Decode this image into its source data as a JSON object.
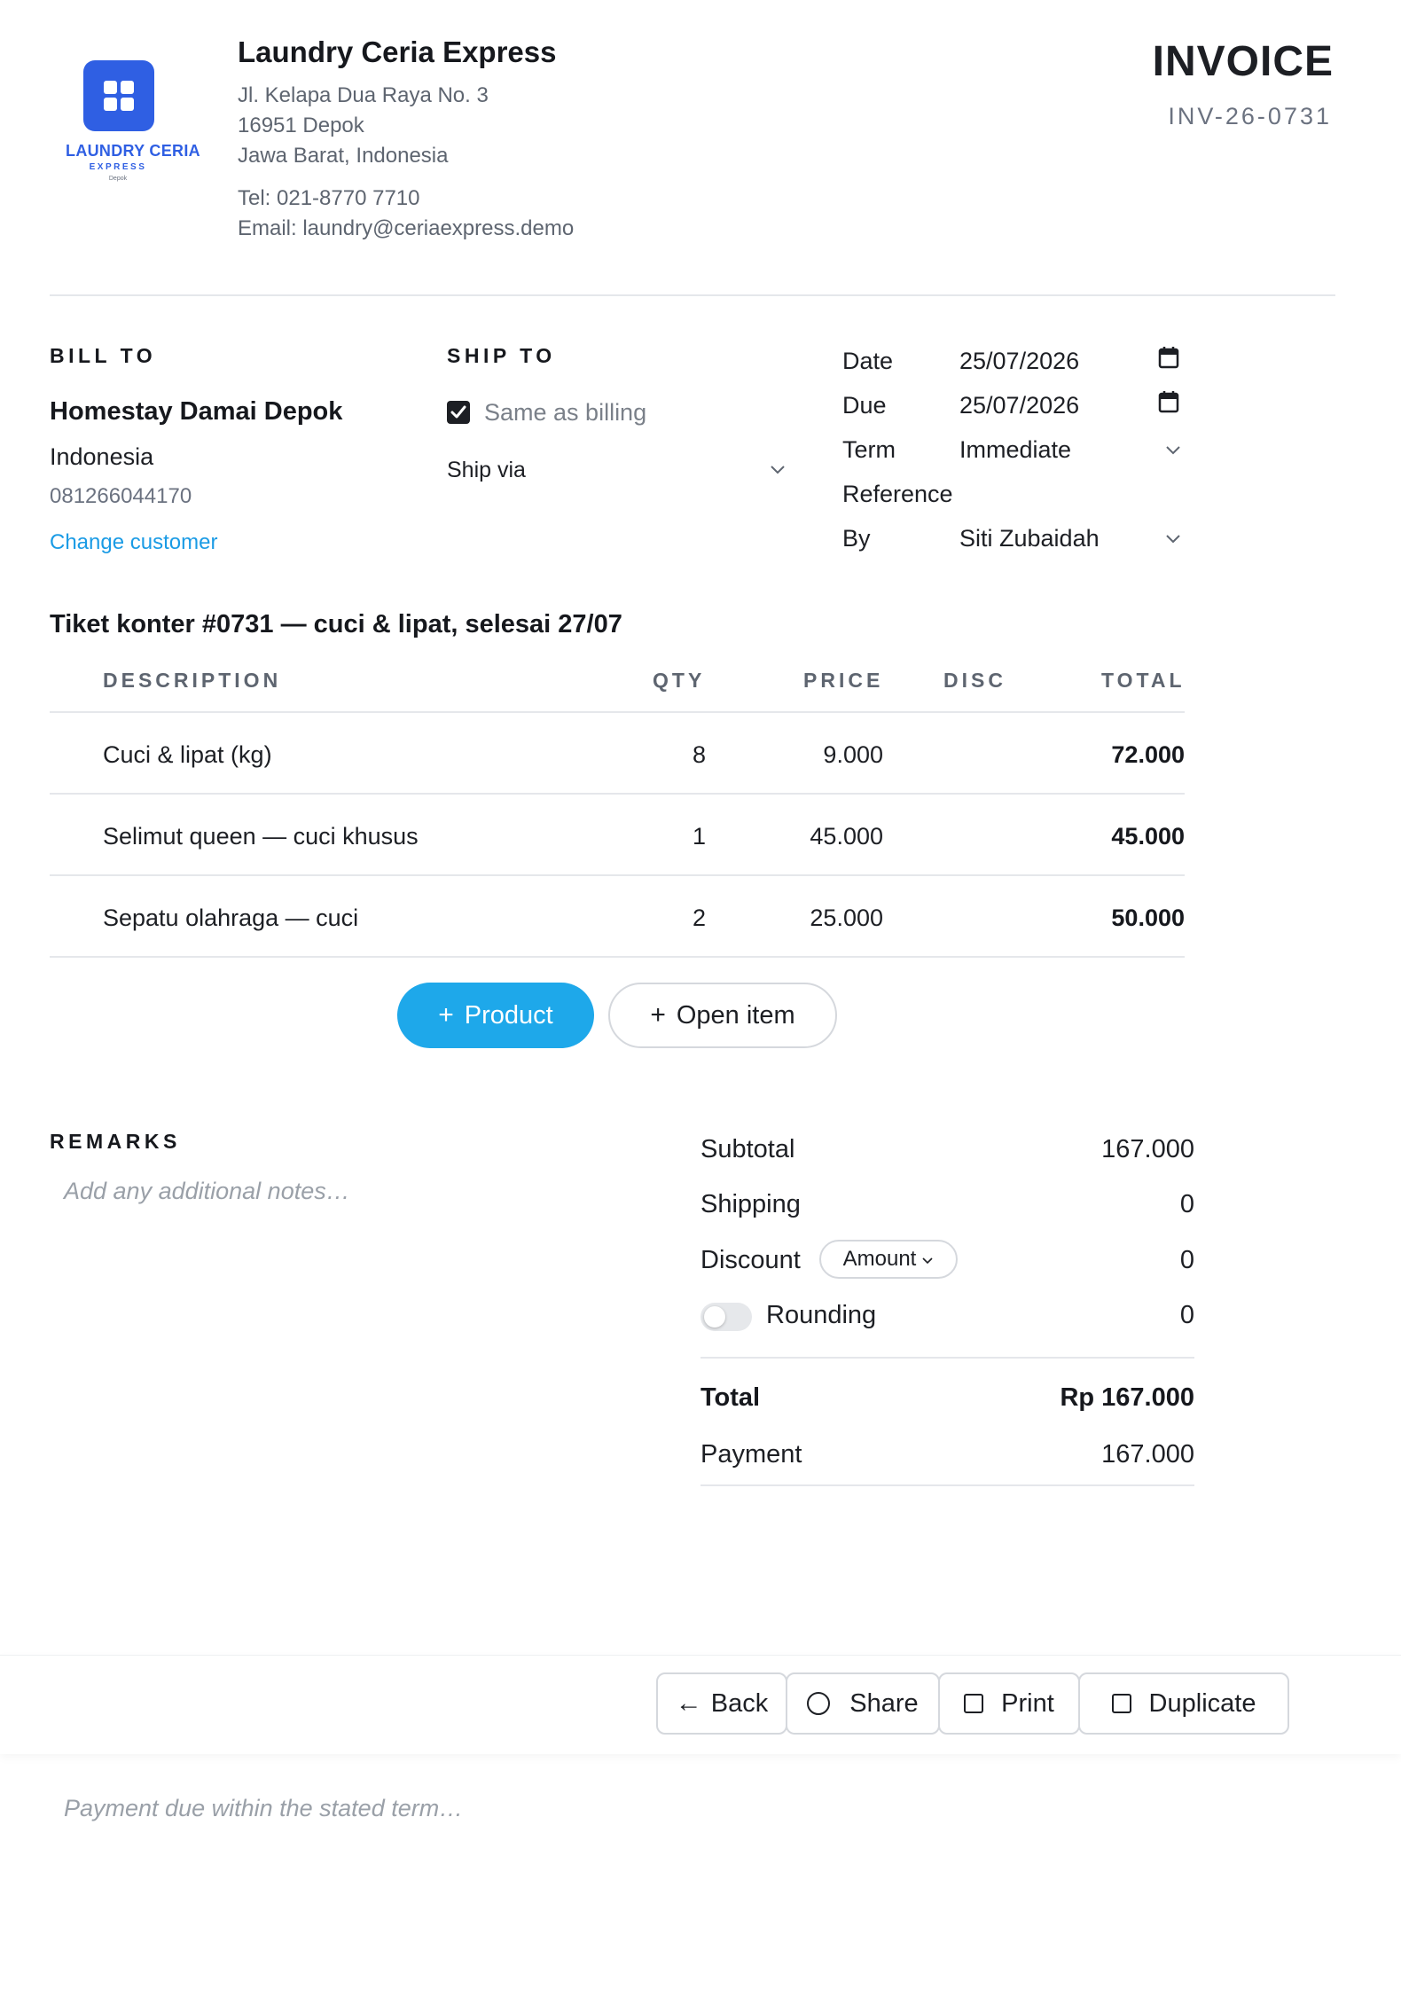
{
  "company": {
    "logo_name": "LAUNDRY CERIA",
    "logo_sub": "EXPRESS",
    "logo_city": "Depok",
    "name": "Laundry Ceria Express",
    "address_lines": [
      "Jl. Kelapa Dua Raya No. 3",
      "16951 Depok",
      "Jawa Barat, Indonesia"
    ],
    "tel": "Tel: 021-8770 7710",
    "email": "Email: laundry@ceriaexpress.demo",
    "brand_color": "#2f5fe3"
  },
  "invoice": {
    "title": "INVOICE",
    "number": "INV-26-0731"
  },
  "bill_to": {
    "label": "BILL TO",
    "name": "Homestay Damai Depok",
    "country": "Indonesia",
    "phone": "081266044170",
    "change_link": "Change customer"
  },
  "ship_to": {
    "label": "SHIP TO",
    "same_as_billing_label": "Same as billing",
    "same_as_billing_checked": true,
    "ship_via_placeholder": "Ship via"
  },
  "meta": {
    "date_label": "Date",
    "date_value": "25/07/2026",
    "due_label": "Due",
    "due_value": "25/07/2026",
    "term_label": "Term",
    "term_value": "Immediate",
    "reference_label": "Reference",
    "by_label": "By",
    "by_value": "Siti Zubaidah"
  },
  "lines": {
    "title": "Tiket konter #0731 — cuci & lipat, selesai 27/07",
    "headers": {
      "description": "DESCRIPTION",
      "qty": "QTY",
      "price": "PRICE",
      "disc": "DISC",
      "total": "TOTAL"
    },
    "rows": [
      {
        "description": "Cuci & lipat (kg)",
        "qty": "8",
        "price": "9.000",
        "disc": "",
        "total": "72.000"
      },
      {
        "description": "Selimut queen — cuci khusus",
        "qty": "1",
        "price": "45.000",
        "disc": "",
        "total": "45.000"
      },
      {
        "description": "Sepatu olahraga — cuci",
        "qty": "2",
        "price": "25.000",
        "disc": "",
        "total": "50.000"
      }
    ],
    "add_product_label": "Product",
    "add_open_item_label": "Open item",
    "accent_color": "#1ea8ea"
  },
  "remarks": {
    "label": "REMARKS",
    "placeholder": "Add any additional notes…"
  },
  "summary": {
    "subtotal_label": "Subtotal",
    "subtotal_value": "167.000",
    "shipping_label": "Shipping",
    "shipping_value": "0",
    "discount_label": "Discount",
    "discount_mode": "Amount",
    "discount_value": "0",
    "rounding_label": "Rounding",
    "rounding_on": false,
    "rounding_value": "0",
    "total_label": "Total",
    "total_value": "Rp 167.000",
    "payment_label": "Payment",
    "payment_value": "167.000"
  },
  "footer": {
    "back_label": "Back",
    "share_label": "Share",
    "print_label": "Print",
    "duplicate_label": "Duplicate",
    "terms_placeholder": "Payment due within the stated term…"
  }
}
